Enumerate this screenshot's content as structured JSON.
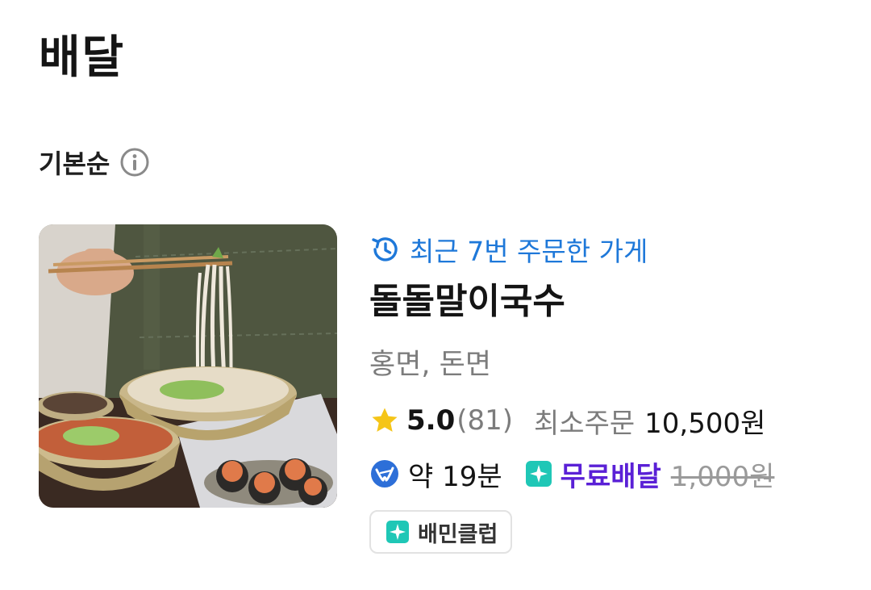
{
  "header": {
    "title": "배달"
  },
  "sort": {
    "label": "기본순",
    "info_icon": "info-circle-icon"
  },
  "store": {
    "recent_badge": "최근 7번 주문한 가게",
    "recent_icon": "history-clock-icon",
    "name": "돌돌말이국수",
    "category": "홍면, 돈면",
    "rating": "5.0",
    "review_count": "(81)",
    "min_order_label": "최소주문",
    "min_order_value": "10,500원",
    "delivery_time": "약 19분",
    "free_delivery_label": "무료배달",
    "original_delivery_fee": "1,000원",
    "club_badge": "배민클럽",
    "thumbnail": "noodle-dish-photo"
  },
  "colors": {
    "accent_blue": "#1e78d9",
    "star": "#f5c518",
    "free_delivery": "#5a20d6",
    "club_teal": "#1fc7b6",
    "muted_text": "#7c7c7c"
  }
}
